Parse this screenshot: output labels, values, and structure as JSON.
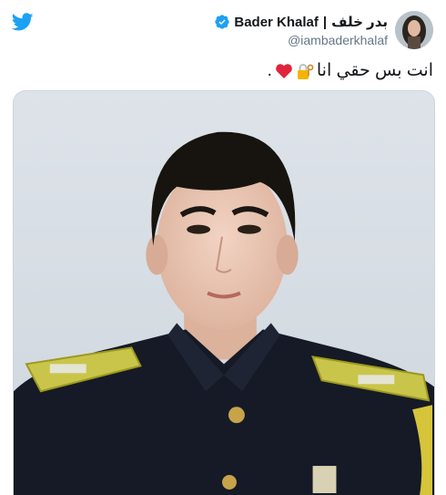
{
  "account": {
    "display_name_arabic": "بدر خلف",
    "separator": "|",
    "display_name_latin": "Bader Khalaf",
    "handle": "@iambaderkhalaf"
  },
  "tweet": {
    "text": "انت بس حقي انا",
    "emojis": [
      "lock-with-key-icon",
      "red-heart-icon"
    ],
    "trailing": "."
  },
  "colors": {
    "twitter_blue": "#1da1f2",
    "text": "#14171a",
    "secondary_text": "#657786",
    "border": "#ccd6dd"
  }
}
